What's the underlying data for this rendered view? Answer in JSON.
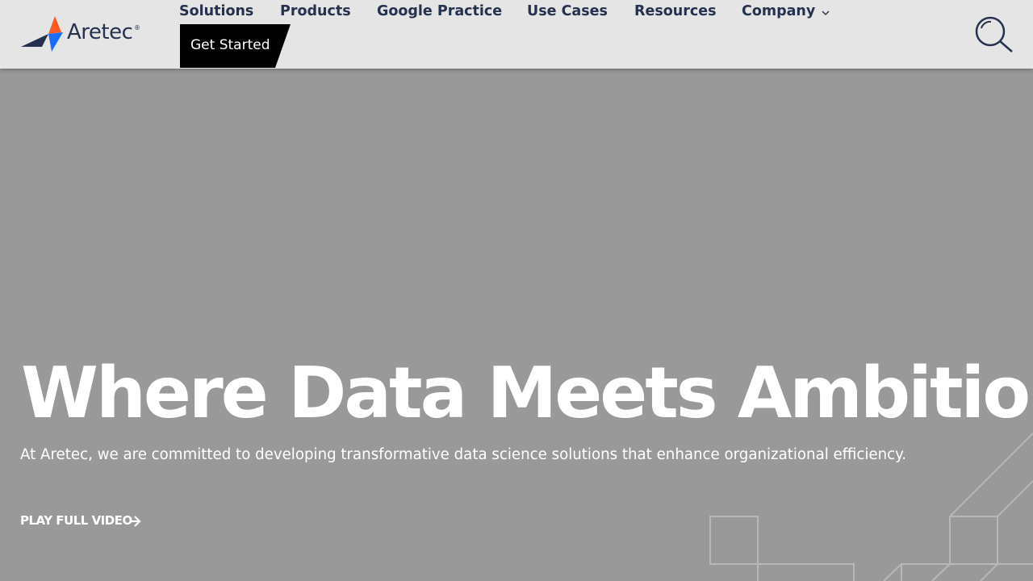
{
  "header": {
    "logo_text": "Aretec",
    "logo_mark": "®",
    "nav": [
      {
        "label": "Solutions"
      },
      {
        "label": "Products"
      },
      {
        "label": "Google Practice"
      },
      {
        "label": "Use Cases"
      },
      {
        "label": "Resources"
      },
      {
        "label": "Company",
        "has_dropdown": true
      }
    ],
    "cta_label": "Get Started",
    "search_icon": "search-icon"
  },
  "hero": {
    "title": "Where Data Meets Ambition",
    "subtitle": "At Aretec, we are committed to developing transformative data science solutions that enhance organizational efficiency.",
    "video_link": "PLAY FULL VIDEO"
  },
  "colors": {
    "header_bg": "#e5e5e5",
    "nav_text": "#24324f",
    "hero_bg": "#999999",
    "cta_bg": "#000000",
    "logo_orange": "#ff5a1f",
    "logo_blue": "#1a6dff"
  }
}
